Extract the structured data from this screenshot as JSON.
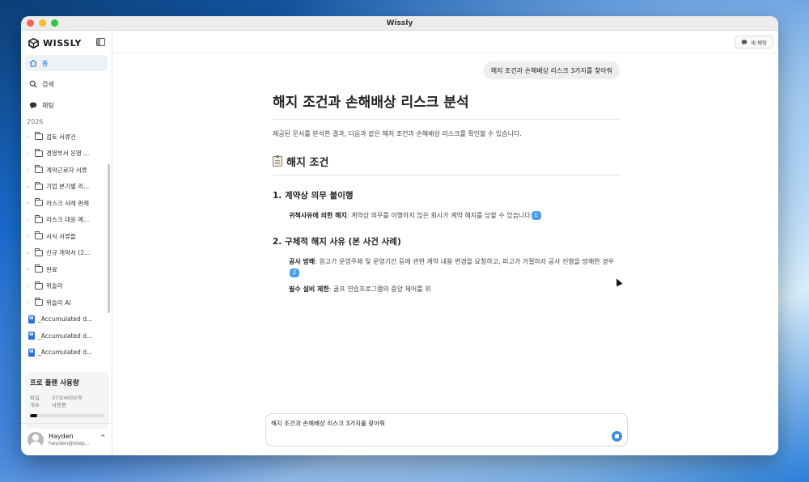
{
  "window": {
    "title": "Wissly"
  },
  "brand": {
    "name": "WISSLY"
  },
  "nav": [
    {
      "label": "홈",
      "icon": "home-icon",
      "active": true
    },
    {
      "label": "검색",
      "icon": "search-icon",
      "active": false
    },
    {
      "label": "채팅",
      "icon": "chat-icon",
      "active": false
    }
  ],
  "sidebar": {
    "year": "2026",
    "folders": [
      {
        "label": "검토 서류건",
        "type": "folder"
      },
      {
        "label": "경영부서 운영 ...",
        "type": "folder"
      },
      {
        "label": "계약근로자 서류",
        "type": "folder"
      },
      {
        "label": "기업 분기별 리...",
        "type": "folder"
      },
      {
        "label": "라스크 사례 판례",
        "type": "folder"
      },
      {
        "label": "리스크 대응 메...",
        "type": "folder"
      },
      {
        "label": "서식 서류들",
        "type": "folder"
      },
      {
        "label": "신규 계약서 (2...",
        "type": "folder"
      },
      {
        "label": "완료",
        "type": "folder"
      },
      {
        "label": "위슬리",
        "type": "folder"
      },
      {
        "label": "위슬리 AI",
        "type": "folder"
      },
      {
        "label": "_Accumulated d...",
        "type": "file"
      },
      {
        "label": "_Accumulated d...",
        "type": "file"
      },
      {
        "label": "_Accumulated d...",
        "type": "file"
      }
    ]
  },
  "usage": {
    "title": "프로 플랜 사용량",
    "key_line1": "파일",
    "key_line2": "개수",
    "value_line1": "373/4000개",
    "value_line2": "사용중",
    "fraction": 0.0933
  },
  "user": {
    "name": "Hayden",
    "email": "hayden@step..."
  },
  "topbar": {
    "new_chat_label": "새 채팅"
  },
  "chat": {
    "user_message": "해지 조건과 손해배상 리스크 3가지를 찾아줘",
    "heading": "해지 조건과 손해배상 리스크 분석",
    "intro": "제공된 문서를 분석한 결과, 다음과 같은 해지 조건과 손해배상 리스크를 확인할 수 있습니다.",
    "section1": "해지 조건",
    "sub1": "1. 계약상 의무 불이행",
    "item1_bold": "귀책사유에 의한 해지",
    "item1_text": ": 계약상 의무를 이행하지 않은 회사가 계약 해지를 당할 수 있습니다",
    "item1_cite": "1",
    "sub2": "2. 구체적 해지 사유 (본 사건 사례)",
    "item2_bold": "공사 방해",
    "item2_text": ": 원고가 운영주체 및 운영기간 등에 관한 계약 내용 변경을 요청하고, 피고가 거절하자 공사 진행을 방해한 경우",
    "item2_cite": "2",
    "item3_bold": "필수 설비 제한",
    "item3_text": ": 골프 연습프로그램의 중앙 제어를 위"
  },
  "composer": {
    "value": "해지 조건과 손해배상 리스크 3가지를 찾아줘"
  },
  "colors": {
    "accent": "#1f6fd1",
    "cite": "#4aa0ec",
    "send": "#3a8ee6"
  }
}
